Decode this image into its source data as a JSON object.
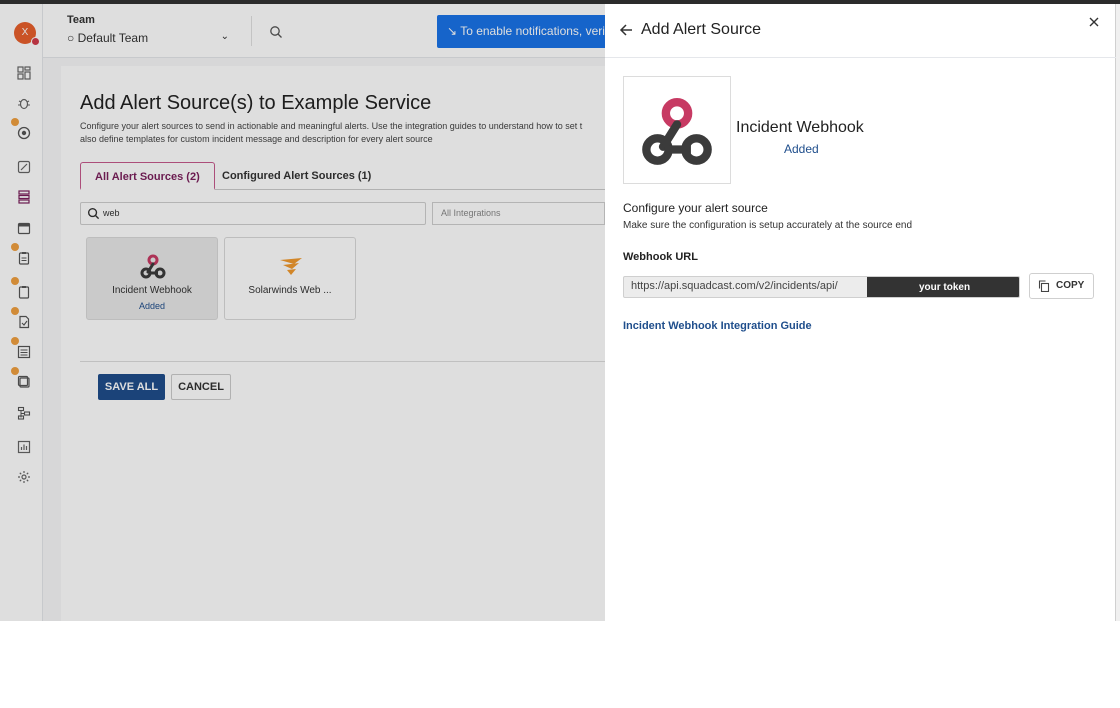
{
  "topbar": {
    "team_label": "Team",
    "team_name": "Default Team",
    "notification_banner": "To enable notifications, verify y"
  },
  "sidebar": {
    "avatar_initial": "X",
    "items": [
      "dashboard-icon",
      "bug-icon",
      "incidents-icon",
      "analytics-edit-icon",
      "services-icon",
      "calendar-icon",
      "runbooks-icon",
      "postmortems-icon",
      "reports-icon",
      "status-page-icon",
      "escalation-icon",
      "workflow-icon",
      "chart-icon",
      "settings-icon"
    ]
  },
  "page": {
    "title": "Add Alert Source(s) to Example Service",
    "description_line1": "Configure your alert sources to send in actionable and meaningful alerts. Use the integration guides to understand how to set t",
    "description_line2": "also define templates for custom incident message and description for every alert source",
    "tabs": [
      {
        "label": "All Alert Sources (2)"
      },
      {
        "label": "Configured Alert Sources (1)"
      }
    ],
    "search_value": "web",
    "filter_placeholder": "All Integrations",
    "cards": [
      {
        "name": "Incident Webhook",
        "status": "Added"
      },
      {
        "name": "Solarwinds Web ...",
        "status": ""
      }
    ],
    "save_label": "SAVE ALL",
    "cancel_label": "CANCEL"
  },
  "panel": {
    "title": "Add Alert Source",
    "integration_name": "Incident Webhook",
    "integration_status": "Added",
    "config_title": "Configure your alert source",
    "config_subtitle": "Make sure the configuration is setup accurately at the source end",
    "webhook_label": "Webhook URL",
    "webhook_url": "https://api.squadcast.com/v2/incidents/api/",
    "token_mask": "your token",
    "copy_label": "COPY",
    "guide_link": "Incident Webhook Integration Guide"
  },
  "colors": {
    "accent_blue": "#1f4e8c",
    "banner_blue": "#1a73e8",
    "tab_active": "#7b1f5c",
    "webhook_pink": "#c73a63",
    "webhook_dark": "#3b3b3b",
    "solarwinds_orange": "#f29a2e"
  }
}
